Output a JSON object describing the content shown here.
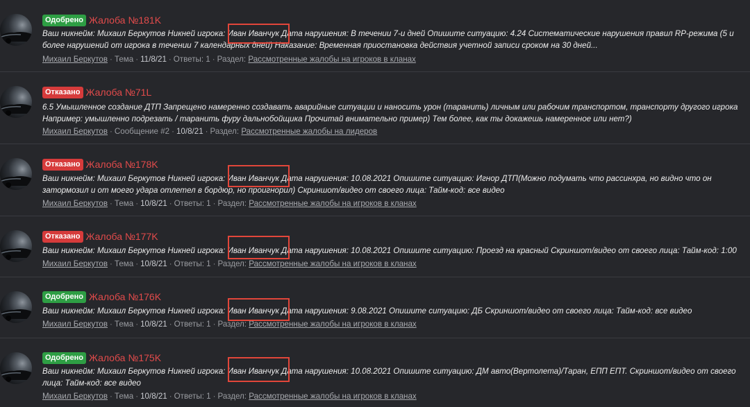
{
  "threads": [
    {
      "badge": "Одобрено",
      "status": "approved",
      "title": "Жалоба №181K",
      "snippet_lines": [
        "Ваш никнейм: Михаил Беркутов Никней игрока: Иван Иванчук Дата нарушения: В течении 7-и дней Опишите ситуацию: 4.24 Систематические нарушения правил RP-режима (5 и",
        "более нарушений от игрока в течении 7 календарных дней) Наказание: Временная приостановка действия учетной записи сроком на 30 дней..."
      ],
      "author": "Михаил Беркутов",
      "kind": "Тема",
      "date": "11/8/21",
      "replies": "Ответы: 1",
      "section_label": "Раздел:",
      "section": "Рассмотренные жалобы на игроков в кланах"
    },
    {
      "badge": "Отказано",
      "status": "rejected",
      "title": "Жалоба №71L",
      "snippet_lines": [
        "6.5 Умышленное создание ДТП Запрещено намеренно создавать аварийные ситуации и наносить урон (таранить) личным или рабочим транспортом, транспорту другого игрока",
        "Например: умышленно подрезать / таранить фуру дальнобойщика Прочитай внимательно пример) Тем более, как ты докажешь намеренное или нет?)"
      ],
      "author": "Михаил Беркутов",
      "kind": "Сообщение #2",
      "date": "10/8/21",
      "replies": "",
      "section_label": "Раздел:",
      "section": "Рассмотренные жалобы на лидеров"
    },
    {
      "badge": "Отказано",
      "status": "rejected",
      "title": "Жалоба №178K",
      "snippet_lines": [
        "Ваш никнейм: Михаил Беркутов Никней игрока: Иван Иванчук Дата нарушения: 10.08.2021 Опишите ситуацию: Игнор ДТП(Можно подумать что рассинхра, но видно что он",
        "затормозил и от моего удара отлетел в бордюр, но проигнорил) Скриншот/видео от своего лица: Тайм-код: все видео"
      ],
      "author": "Михаил Беркутов",
      "kind": "Тема",
      "date": "10/8/21",
      "replies": "Ответы: 1",
      "section_label": "Раздел:",
      "section": "Рассмотренные жалобы на игроков в кланах"
    },
    {
      "badge": "Отказано",
      "status": "rejected",
      "title": "Жалоба №177K",
      "snippet_lines": [
        "Ваш никнейм: Михаил Беркутов Никней игрока: Иван Иванчук Дата нарушения: 10.08.2021 Опишите ситуацию: Проезд на красный Скриншот/видео от своего лица: Тайм-код: 1:00"
      ],
      "author": "Михаил Беркутов",
      "kind": "Тема",
      "date": "10/8/21",
      "replies": "Ответы: 1",
      "section_label": "Раздел:",
      "section": "Рассмотренные жалобы на игроков в кланах"
    },
    {
      "badge": "Одобрено",
      "status": "approved",
      "title": "Жалоба №176K",
      "snippet_lines": [
        "Ваш никнейм: Михаил Беркутов Никней игрока: Иван Иванчук Дата нарушения: 9.08.2021 Опишите ситуацию: ДБ Скриншот/видео от своего лица: Тайм-код: все видео"
      ],
      "author": "Михаил Беркутов",
      "kind": "Тема",
      "date": "10/8/21",
      "replies": "Ответы: 1",
      "section_label": "Раздел:",
      "section": "Рассмотренные жалобы на игроков в кланах"
    },
    {
      "badge": "Одобрено",
      "status": "approved",
      "title": "Жалоба №175K",
      "snippet_lines": [
        "Ваш никнейм: Михаил Беркутов Никней игрока: Иван Иванчук Дата нарушения: 10.08.2021 Опишите ситуацию: ДМ авто(Вертолета)/Таран, ЕПП ЕПТ. Скриншот/видео от своего",
        "лица: Тайм-код: все видео"
      ],
      "author": "Михаил Беркутов",
      "kind": "Тема",
      "date": "10/8/21",
      "replies": "Ответы: 1",
      "section_label": "Раздел:",
      "section": "Рассмотренные жалобы на игроков в кланах"
    }
  ],
  "colors": {
    "background": "#26272b",
    "approved": "#2e9e44",
    "rejected": "#d63b3b",
    "title": "#e24b4b",
    "highlight": "#e2463a"
  },
  "icons": {
    "avatar": "car-photo-avatar"
  }
}
